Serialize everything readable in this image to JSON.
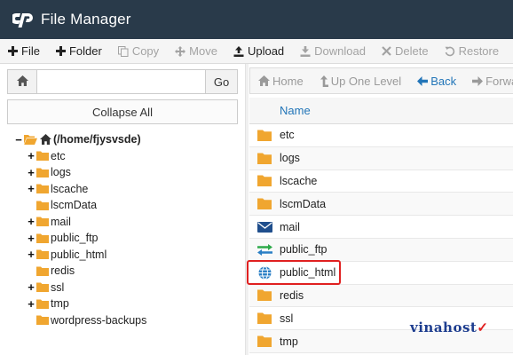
{
  "header": {
    "title": "File Manager"
  },
  "toolbar": {
    "items": [
      {
        "label": "File",
        "icon": "plus-icon",
        "enabled": true
      },
      {
        "label": "Folder",
        "icon": "plus-icon",
        "enabled": true
      },
      {
        "label": "Copy",
        "icon": "copy-icon",
        "enabled": false
      },
      {
        "label": "Move",
        "icon": "move-icon",
        "enabled": false
      },
      {
        "label": "Upload",
        "icon": "upload-icon",
        "enabled": true
      },
      {
        "label": "Download",
        "icon": "download-icon",
        "enabled": false
      },
      {
        "label": "Delete",
        "icon": "delete-icon",
        "enabled": false
      },
      {
        "label": "Restore",
        "icon": "restore-icon",
        "enabled": false
      }
    ]
  },
  "address": {
    "value": "",
    "go_label": "Go"
  },
  "collapse_label": "Collapse All",
  "tree": {
    "root_label": "(/home/fjysvsde)",
    "children": [
      {
        "label": "etc",
        "expandable": true
      },
      {
        "label": "logs",
        "expandable": true
      },
      {
        "label": "lscache",
        "expandable": true
      },
      {
        "label": "lscmData",
        "expandable": false
      },
      {
        "label": "mail",
        "expandable": true
      },
      {
        "label": "public_ftp",
        "expandable": true
      },
      {
        "label": "public_html",
        "expandable": true
      },
      {
        "label": "redis",
        "expandable": false
      },
      {
        "label": "ssl",
        "expandable": true
      },
      {
        "label": "tmp",
        "expandable": true
      },
      {
        "label": "wordpress-backups",
        "expandable": false
      }
    ]
  },
  "nav": {
    "items": [
      {
        "label": "Home",
        "icon": "home-icon",
        "enabled": false
      },
      {
        "label": "Up One Level",
        "icon": "up-arrow-icon",
        "enabled": false
      },
      {
        "label": "Back",
        "icon": "back-arrow-icon",
        "enabled": true
      },
      {
        "label": "Forward",
        "icon": "forward-arrow-icon",
        "enabled": false
      }
    ]
  },
  "table": {
    "header_name": "Name",
    "rows": [
      {
        "name": "etc",
        "icon": "folder-icon"
      },
      {
        "name": "logs",
        "icon": "folder-icon"
      },
      {
        "name": "lscache",
        "icon": "folder-icon"
      },
      {
        "name": "lscmData",
        "icon": "folder-icon"
      },
      {
        "name": "mail",
        "icon": "mail-icon"
      },
      {
        "name": "public_ftp",
        "icon": "ftp-transfer-icon"
      },
      {
        "name": "public_html",
        "icon": "globe-icon"
      },
      {
        "name": "redis",
        "icon": "folder-icon"
      },
      {
        "name": "ssl",
        "icon": "folder-icon"
      },
      {
        "name": "tmp",
        "icon": "folder-icon"
      }
    ]
  },
  "watermark": {
    "text": "vinahost",
    "mark": "✓"
  },
  "colors": {
    "header_bg": "#293a4a",
    "folder": "#f0a630",
    "link": "#2275b8",
    "highlight": "#e02020",
    "mail": "#1f4e8c",
    "ftp_green": "#2eaa4a",
    "ftp_blue": "#2a7fc5"
  }
}
